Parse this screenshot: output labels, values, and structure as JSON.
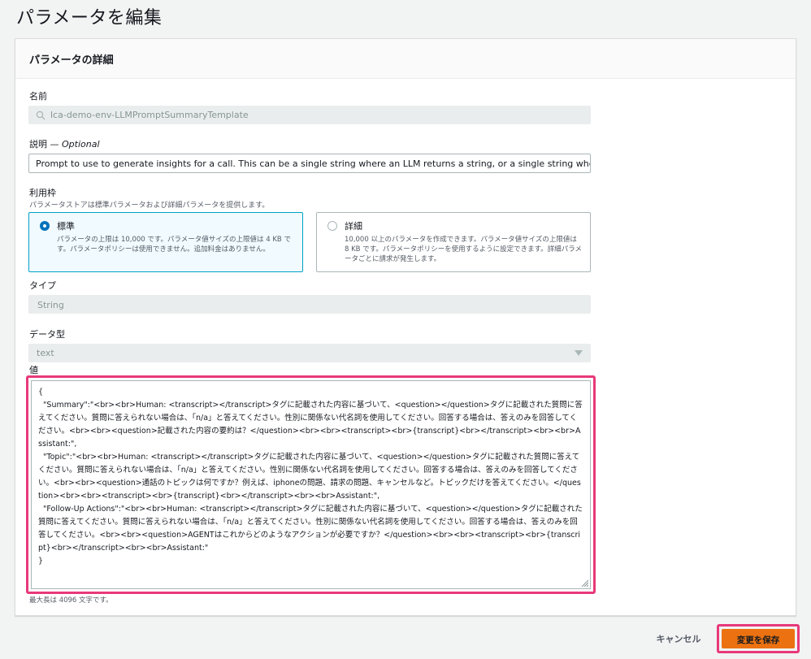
{
  "page": {
    "title": "パラメータを編集"
  },
  "panel": {
    "header": "パラメータの詳細"
  },
  "name_field": {
    "label": "名前",
    "value": "lca-demo-env-LLMPromptSummaryTemplate",
    "icon": "search-icon"
  },
  "description_field": {
    "label": "説明",
    "optional": " — Optional",
    "value": "Prompt to use to generate insights for a call. This can be a single string where an LLM returns a string, or a single string where the LLI"
  },
  "tier": {
    "label": "利用枠",
    "description": "パラメータストアは標準パラメータおよび詳細パラメータを提供します。",
    "options": [
      {
        "title": "標準",
        "selected": true,
        "description": "パラメータの上限は 10,000 です。パラメータ値サイズの上限値は 4 KB です。パラメータポリシーは使用できません。追加料金はありません。"
      },
      {
        "title": "詳細",
        "selected": false,
        "description": "10,000 以上のパラメータを作成できます。パラメータ値サイズの上限値は 8 KB です。パラメータポリシーを使用するように設定できます。詳細パラメータごとに請求が発生します。"
      }
    ]
  },
  "type_field": {
    "label": "タイプ",
    "value": "String"
  },
  "datatype_field": {
    "label": "データ型",
    "value": "text"
  },
  "value_field": {
    "label": "値",
    "content": "{\n  \"Summary\":\"<br><br>Human: <transcript></transcript>タグに記載された内容に基づいて、<question></question>タグに記載された質問に答えてください。質問に答えられない場合は、「n/a」と答えてください。性別に関係ない代名詞を使用してください。回答する場合は、答えのみを回答してください。<br><br><question>記載された内容の要約は？</question><br><br><transcript><br>{transcript}<br></transcript><br><br>Assistant:\",\n  \"Topic\":\"<br><br>Human: <transcript></transcript>タグに記載された内容に基づいて、<question></question>タグに記載された質問に答えてください。質問に答えられない場合は、「n/a」と答えてください。性別に関係ない代名詞を使用してください。回答する場合は、答えのみを回答してください。<br><br><question>通話のトピックは何ですか？例えば、iphoneの問題、請求の問題、キャンセルなど。トピックだけを答えてください。</question><br><br><transcript><br>{transcript}<br></transcript><br><br>Assistant:\",\n  \"Follow-Up Actions\":\"<br><br>Human: <transcript></transcript>タグに記載された内容に基づいて、<question></question>タグに記載された質問に答えてください。質問に答えられない場合は、「n/a」と答えてください。性別に関係ない代名詞を使用してください。回答する場合は、答えのみを回答してください。<br><br><question>AGENTはこれからどのようなアクションが必要ですか？</question><br><br><transcript><br>{transcript}<br></transcript><br><br>Assistant:\"\n}",
    "note": "最大長は 4096 文字です。"
  },
  "actions": {
    "cancel_label": "キャンセル",
    "save_label": "変更を保存"
  },
  "colors": {
    "accent": "#0073bb",
    "primary_button": "#ec7211",
    "highlight": "#e8397a"
  }
}
